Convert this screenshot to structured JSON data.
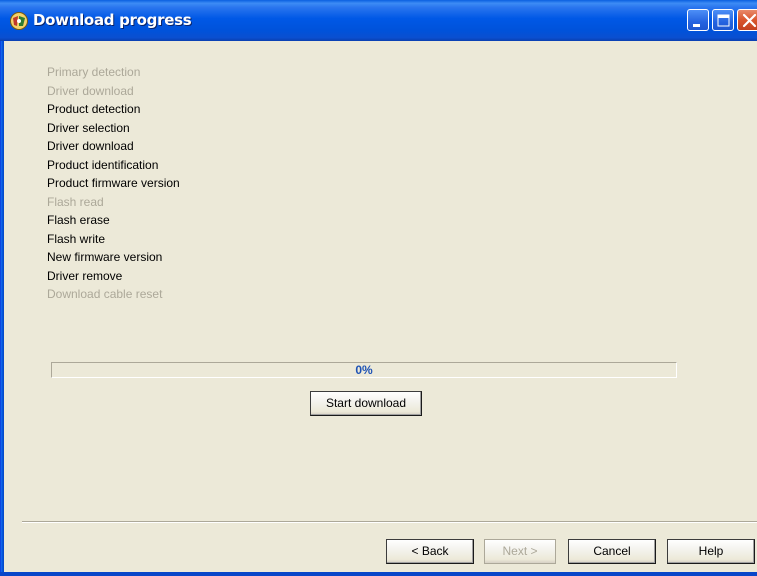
{
  "window": {
    "title": "Download progress",
    "icon": "app-logo-icon"
  },
  "titlebar_buttons": {
    "minimize_icon": "minimize-icon",
    "maximize_icon": "maximize-icon",
    "close_icon": "close-icon"
  },
  "steps": [
    {
      "label": "Primary detection",
      "enabled": false
    },
    {
      "label": "Driver download",
      "enabled": false
    },
    {
      "label": "Product detection",
      "enabled": true
    },
    {
      "label": "Driver selection",
      "enabled": true
    },
    {
      "label": "Driver download",
      "enabled": true
    },
    {
      "label": "Product identification",
      "enabled": true
    },
    {
      "label": "Product firmware version",
      "enabled": true
    },
    {
      "label": "Flash read",
      "enabled": false
    },
    {
      "label": "Flash erase",
      "enabled": true
    },
    {
      "label": "Flash write",
      "enabled": true
    },
    {
      "label": "New firmware version",
      "enabled": true
    },
    {
      "label": "Driver remove",
      "enabled": true
    },
    {
      "label": "Download cable reset",
      "enabled": false
    }
  ],
  "progress": {
    "value": 0,
    "label": "0%"
  },
  "actions": {
    "start_download": "Start download"
  },
  "footer": {
    "back": "< Back",
    "next": "Next >",
    "cancel": "Cancel",
    "help": "Help"
  },
  "colors": {
    "titlebar": "#0058e6",
    "window_bg": "#ece9d8",
    "disabled_text": "#aca899",
    "progress_text": "#1d52b5"
  }
}
